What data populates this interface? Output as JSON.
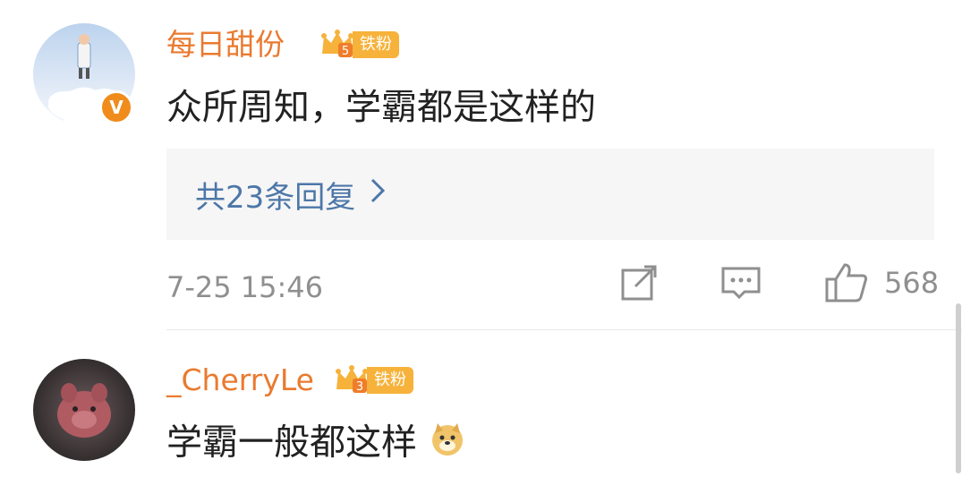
{
  "comments": [
    {
      "username": "每日甜份",
      "fan_badge": {
        "level": "5",
        "label": "铁粉"
      },
      "text": "众所周知，学霸都是这样的",
      "replies_label": "共23条回复",
      "time": "7-25 15:46",
      "likes": "568",
      "verified_badge": "V"
    },
    {
      "username": "_CherryLe",
      "fan_badge": {
        "level": "3",
        "label": "铁粉"
      },
      "text": "学霸一般都这样"
    }
  ],
  "icons": {
    "share": "share-icon",
    "comment": "comment-icon",
    "like": "like-icon",
    "emoji": "doge-emoji-icon",
    "chevron": "chevron-right-icon"
  },
  "colors": {
    "username": "#ea7a2f",
    "reply_link": "#4d77a8",
    "meta": "#8f8f8f",
    "fan_badge": "#f6b23a",
    "verified": "#f08c1c"
  }
}
